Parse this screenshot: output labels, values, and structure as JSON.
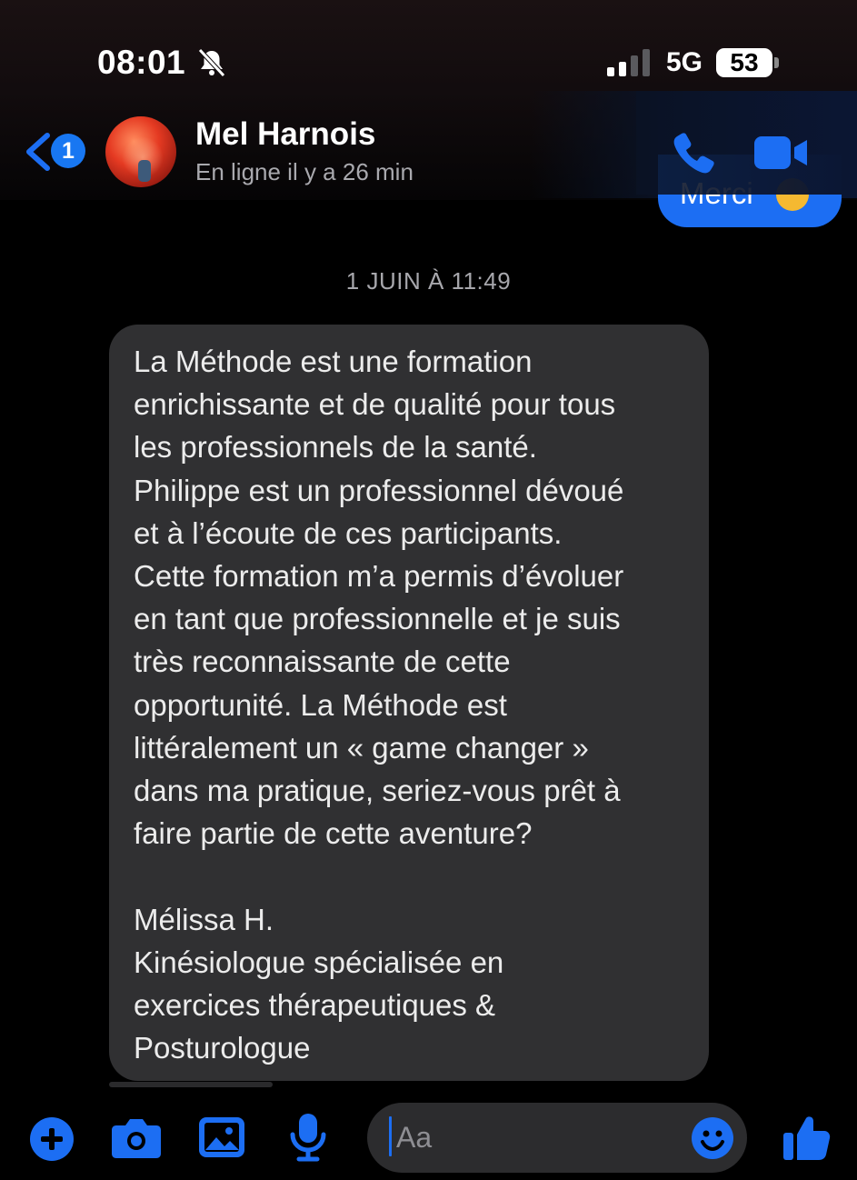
{
  "status_bar": {
    "time": "08:01",
    "network": "5G",
    "battery": "53"
  },
  "header": {
    "back_badge": "1",
    "contact_name": "Mel Harnois",
    "contact_status": "En ligne il y a 26 min"
  },
  "previous_message": {
    "text": "Merci"
  },
  "conversation": {
    "date_separator": "1 JUIN À 11:49",
    "message": "La Méthode est une formation\nenrichissante et de qualité pour tous\nles professionnels de la santé.\nPhilippe est un professionnel dévoué\net à l’écoute de ces participants.\nCette formation m’a permis d’évoluer\nen tant que professionnelle et je suis\ntrès reconnaissante de cette\nopportunité. La Méthode est\nlittéralement un « game changer »\ndans ma pratique, seriez-vous prêt à\nfaire partie de cette aventure?\n\nMélissa H.\nKinésiologue spécialisée en\nexercices thérapeutiques &\nPosturologue"
  },
  "composer": {
    "placeholder": "Aa"
  },
  "colors": {
    "accent": "#1c6ef3",
    "bubble_incoming": "#303032",
    "background": "#000000"
  },
  "icons": [
    "bell-muted-icon",
    "signal-icon",
    "back-chevron-icon",
    "phone-icon",
    "video-icon",
    "plus-icon",
    "camera-icon",
    "gallery-icon",
    "microphone-icon",
    "emoji-icon",
    "thumbs-up-icon"
  ]
}
